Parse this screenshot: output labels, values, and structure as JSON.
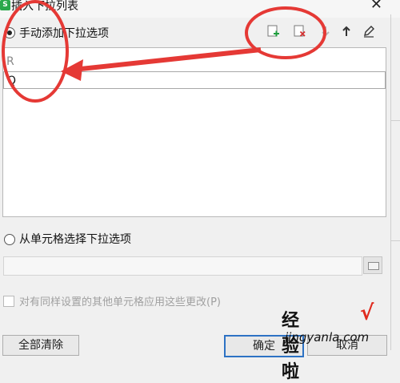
{
  "dialog": {
    "title": "插入下拉列表",
    "app_icon_label": "S",
    "close_glyph": "✕"
  },
  "manual_option": {
    "label": "手动添加下拉选项",
    "selected": true
  },
  "toolbar": {
    "add_icon": "add-item",
    "delete_icon": "delete-item",
    "move_down_icon": "arrow-down",
    "move_up_icon": "arrow-up",
    "edit_icon": "pencil"
  },
  "list": {
    "items": [
      "R",
      "Q"
    ]
  },
  "cell_option": {
    "label": "从单元格选择下拉选项",
    "selected": false
  },
  "apply_same": {
    "label": "对有同样设置的其他单元格应用这些更改(P)",
    "checked": false
  },
  "buttons": {
    "clear_all": "全部清除",
    "ok": "确定",
    "cancel": "取消"
  },
  "annotation": {
    "color": "#e53935"
  },
  "watermark": {
    "cn": "经验啦",
    "check": "√",
    "en": "jingyanla.com"
  }
}
